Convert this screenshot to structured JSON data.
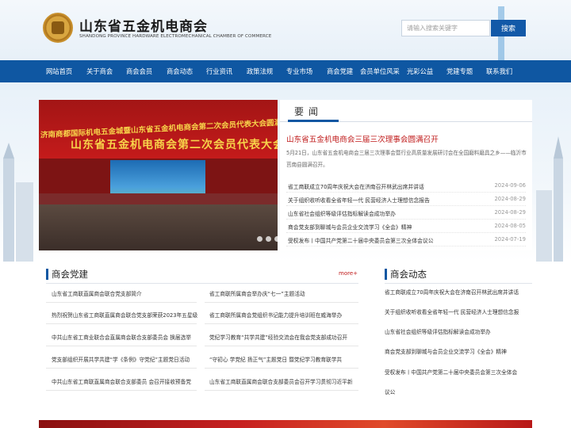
{
  "header": {
    "title": "山东省五金机电商会",
    "subtitle": "SHANDONG PROVINCE HARDWARE ELECTROMECHANICAL CHAMBER OF COMMERCE",
    "search_placeholder": "请输入搜索关键字",
    "search_button": "搜索"
  },
  "nav": {
    "items": [
      "网站首页",
      "关于商会",
      "商会会员",
      "商会动态",
      "行业资讯",
      "政策法规",
      "专业市场",
      "商会党建",
      "会员单位风采",
      "光彩公益",
      "党建专题",
      "联系我们"
    ]
  },
  "slide": {
    "banner_line1": "济南商都国际机电五金城暨山东省五金机电商会第二次会员代表大会圆满成功",
    "banner_line2": "山东省五金机电商会第二次会员代表大会"
  },
  "news": {
    "tab": "要闻",
    "headline": "山东省五金机电商会三届三次理事会圆满召开",
    "summary": "5月21日，山东省五金机电商会三届三次理事会暨行业高质量发展研讨会在全国磨料磨具之乡——临沂市莒南县圆满召开。",
    "list": [
      {
        "title": "省工商联成立70周年庆祝大会在济南召开林武出席并讲话",
        "date": "2024-09-06"
      },
      {
        "title": "关于组织收听收看全省年轻一代 民营经济人士理想信念报告",
        "date": "2024-08-29"
      },
      {
        "title": "山东省社会组织等级评估指标解读会成功举办",
        "date": "2024-08-29"
      },
      {
        "title": "商会党支部到聊城与会员企业交流学习《全会》精神",
        "date": "2024-08-05"
      },
      {
        "title": "受权发布丨中国共产党第二十届中央委员会第三次全体会议公",
        "date": "2024-07-19"
      }
    ]
  },
  "party": {
    "title": "商会党建",
    "more": "more+",
    "left": [
      "山东省工商联直属商会联合党支部简介",
      "热烈祝贺山东省工商联直属商会联合党支部荣获2023年五星级",
      "中共山东省工商业联合会直属商会联合支部委员会 换届选举",
      "党支部组织开展共学共建“学《条例》守党纪”主题党日活动",
      "中共山东省工商联直属商会联合支部委员 会召开接收预备党"
    ],
    "right": [
      "省工商联所属商会举办庆“七一”主题活动",
      "省工商联所属商会党组织书记能力提升培训班在威海举办",
      "党纪学习教育“共学共建”经验交流会在我会党支部成功召开",
      "“守初心 学党纪 扬正气”主题党日 暨党纪学习教育联学共",
      "山东省工商联直属商会联合支部委员会召开学习贯彻习近平新"
    ]
  },
  "dynamics": {
    "title": "商会动态",
    "items": [
      "省工商联成立70周年庆祝大会在济南召开林武出席并讲话",
      "关于组织收听收看全省年轻一代 民营经济人士理想信念报",
      "山东省社会组织等级评估指标解读会成功举办",
      "商会党支部到聊城与会员企业交流学习《全会》精神",
      "受权发布丨中国共产党第二十届中央委员会第三次全体会",
      "议公"
    ]
  }
}
